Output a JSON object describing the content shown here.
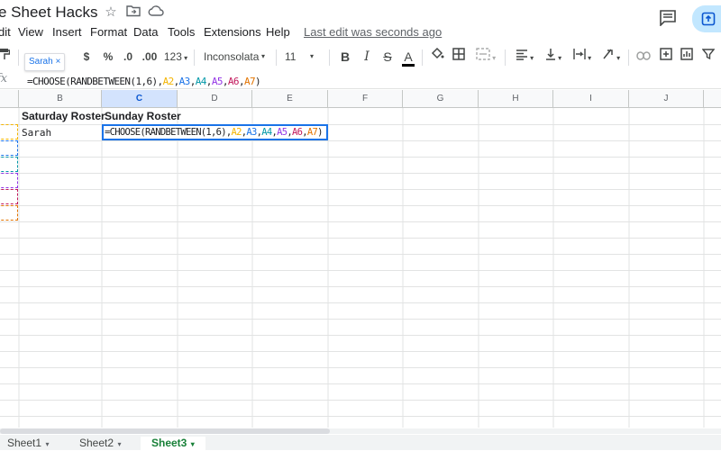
{
  "title": "e Sheet Hacks",
  "menu": [
    "dit",
    "View",
    "Insert",
    "Format",
    "Data",
    "Tools",
    "Extensions",
    "Help"
  ],
  "last_edit": "Last edit was seconds ago",
  "toolbar": {
    "currency": "$",
    "percent": "%",
    "decimal_decrease": ".0",
    "decimal_increase": ".00",
    "more_formats": "123",
    "font": "Inconsolata",
    "font_size": "11",
    "bold": "B",
    "italic": "I",
    "strike": "S",
    "text_color": "A"
  },
  "name_chip": "Sarah ×",
  "formula_bar": {
    "fx": "fx",
    "parts": [
      {
        "t": "=CHOOSE(RANDBETWEEN(1,6),",
        "c": "#202124"
      },
      {
        "t": "A2",
        "c": "#f4b400"
      },
      {
        "t": ",",
        "c": "#202124"
      },
      {
        "t": "A3",
        "c": "#1a73e8"
      },
      {
        "t": ",",
        "c": "#202124"
      },
      {
        "t": "A4",
        "c": "#0097a7"
      },
      {
        "t": ",",
        "c": "#202124"
      },
      {
        "t": "A5",
        "c": "#9334e6"
      },
      {
        "t": ",",
        "c": "#202124"
      },
      {
        "t": "A6",
        "c": "#c2185b"
      },
      {
        "t": ",",
        "c": "#202124"
      },
      {
        "t": "A7",
        "c": "#e37400"
      },
      {
        "t": ")",
        "c": "#202124"
      }
    ]
  },
  "columns": [
    "B",
    "C",
    "D",
    "E",
    "F",
    "G",
    "H",
    "I",
    "J"
  ],
  "selected_column": "C",
  "cells": {
    "B1": "Saturday Roster",
    "C1": "Sunday Roster",
    "B2": "Sarah"
  },
  "range_colors": [
    "#f4b400",
    "#1a73e8",
    "#0097a7",
    "#9334e6",
    "#c2185b",
    "#e37400"
  ],
  "sheets": [
    "Sheet1",
    "Sheet2",
    "Sheet3"
  ],
  "active_sheet": "Sheet3",
  "colors": {
    "accent": "#1a73e8",
    "active_tab": "#188038"
  }
}
